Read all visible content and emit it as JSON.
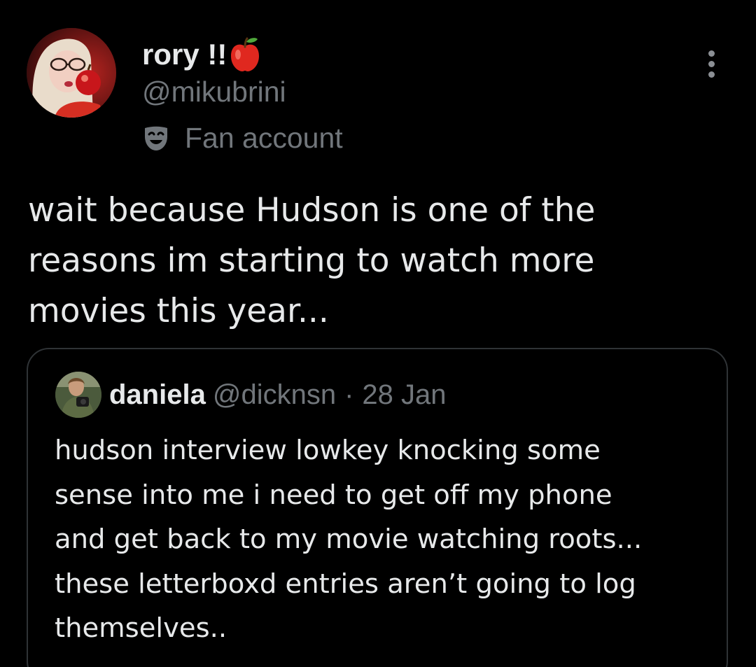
{
  "tweet": {
    "author": {
      "display_name": "rory !!",
      "name_emoji_icon": "apple-icon",
      "handle": "@mikubrini",
      "label_icon": "theater-mask-icon",
      "label": "Fan account"
    },
    "more_icon": "more-options-icon",
    "text": "wait because Hudson is one of the\nreasons im starting to watch more\nmovies this year..."
  },
  "quoted_tweet": {
    "author": {
      "display_name": "daniela",
      "handle": "@dicknsn"
    },
    "separator": "·",
    "date": "28 Jan",
    "text": "hudson interview lowkey knocking some\nsense into me i need to get off my phone\nand get back to my movie watching roots...\nthese letterboxd entries aren’t going to log\nthemselves.."
  },
  "colors": {
    "background": "#000000",
    "primary_text": "#e7e9ea",
    "secondary_text": "#71767b",
    "border": "#2f3336"
  }
}
